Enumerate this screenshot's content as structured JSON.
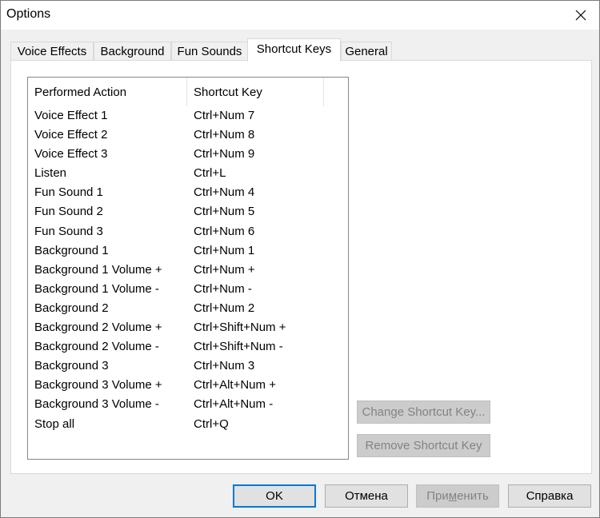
{
  "window": {
    "title": "Options"
  },
  "tabs": [
    {
      "label": "Voice Effects"
    },
    {
      "label": "Background"
    },
    {
      "label": "Fun Sounds"
    },
    {
      "label": "Shortcut Keys",
      "active": true
    },
    {
      "label": "General"
    }
  ],
  "shortcuts": {
    "columns": [
      "Performed Action",
      "Shortcut Key"
    ],
    "rows": [
      {
        "action": "Voice Effect 1",
        "key": "Ctrl+Num 7"
      },
      {
        "action": "Voice Effect 2",
        "key": "Ctrl+Num 8"
      },
      {
        "action": "Voice Effect 3",
        "key": "Ctrl+Num 9"
      },
      {
        "action": "Listen",
        "key": "Ctrl+L"
      },
      {
        "action": "Fun Sound 1",
        "key": "Ctrl+Num 4"
      },
      {
        "action": "Fun Sound 2",
        "key": "Ctrl+Num 5"
      },
      {
        "action": "Fun Sound 3",
        "key": "Ctrl+Num 6"
      },
      {
        "action": "Background 1",
        "key": "Ctrl+Num 1"
      },
      {
        "action": "Background 1 Volume +",
        "key": "Ctrl+Num +"
      },
      {
        "action": "Background 1 Volume -",
        "key": "Ctrl+Num -"
      },
      {
        "action": "Background 2",
        "key": "Ctrl+Num 2"
      },
      {
        "action": "Background 2 Volume +",
        "key": "Ctrl+Shift+Num +"
      },
      {
        "action": "Background 2 Volume -",
        "key": "Ctrl+Shift+Num -"
      },
      {
        "action": "Background 3",
        "key": "Ctrl+Num 3"
      },
      {
        "action": "Background 3 Volume +",
        "key": "Ctrl+Alt+Num +"
      },
      {
        "action": "Background 3 Volume -",
        "key": "Ctrl+Alt+Num -"
      },
      {
        "action": "Stop all",
        "key": "Ctrl+Q"
      }
    ]
  },
  "buttons": {
    "change_shortcut": "Change Shortcut Key...",
    "remove_shortcut": "Remove Shortcut Key",
    "ok": "OK",
    "cancel": "Отмена",
    "apply_prefix": "При",
    "apply_underlined": "м",
    "apply_suffix": "енить",
    "help": "Справка"
  },
  "icons": {
    "close": "close-icon"
  }
}
